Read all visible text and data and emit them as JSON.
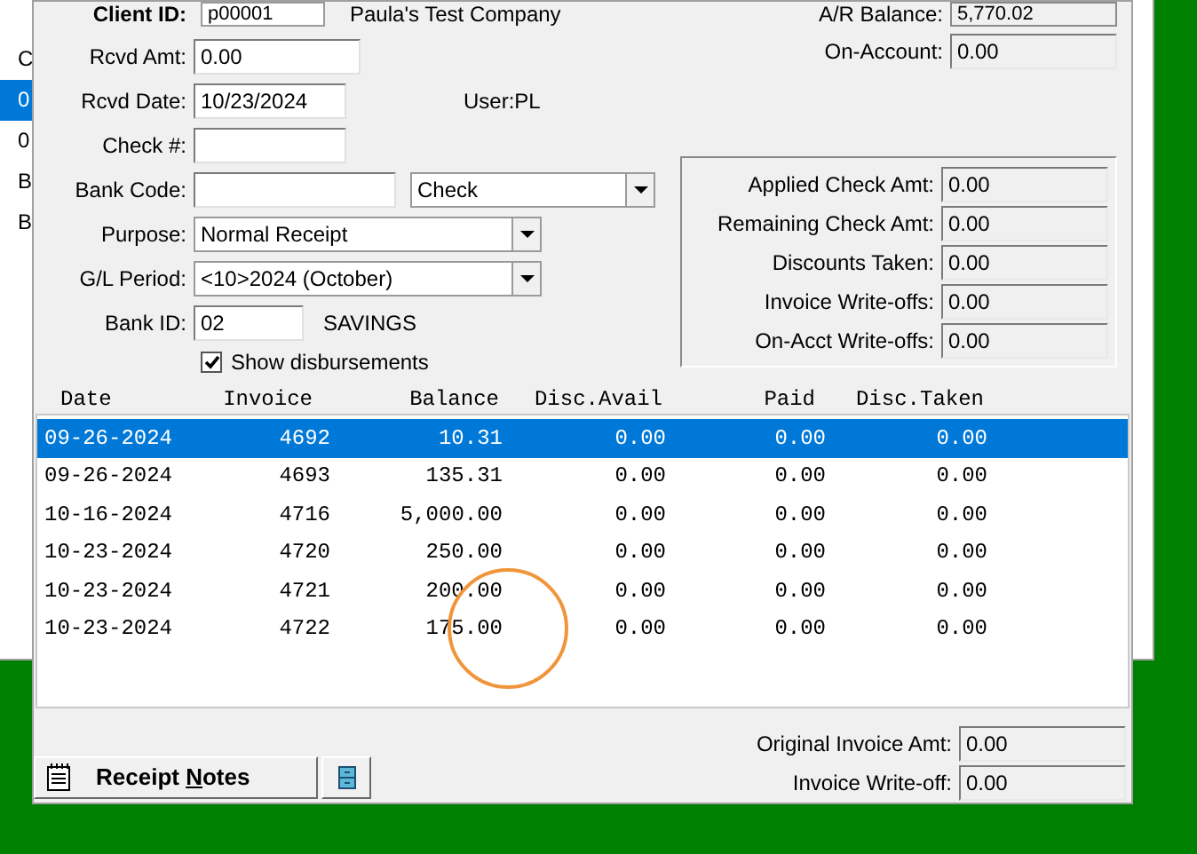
{
  "background_window": {
    "rows": [
      {
        "text": "C",
        "selected": false
      },
      {
        "text": "0",
        "selected": true
      },
      {
        "text": "0",
        "selected": false
      },
      {
        "text": "B",
        "selected": false
      },
      {
        "text": "B",
        "selected": false
      }
    ]
  },
  "header": {
    "client_label": "Client ID:",
    "client_id": "p00001",
    "client_name": "Paula's Test Company",
    "ar_label": "A/R Balance:",
    "ar_value": "5,770.02",
    "on_account_label": "On-Account:",
    "on_account_value": "0.00"
  },
  "form": {
    "rcvd_amt_label": "Rcvd Amt:",
    "rcvd_amt": "0.00",
    "rcvd_date_label": "Rcvd Date:",
    "rcvd_date": "10/23/2024",
    "user": "User:PL",
    "check_label": "Check #:",
    "bank_code_label": "Bank Code:",
    "payment_type": "Check",
    "purpose_label": "Purpose:",
    "purpose": "Normal Receipt",
    "gl_label": "G/L Period:",
    "gl_period": "<10>2024 (October)",
    "bank_id_label": "Bank ID:",
    "bank_id": "02",
    "bank_name": "SAVINGS",
    "show_disbursements": {
      "label": "Show disbursements",
      "checked": true
    }
  },
  "summary": [
    {
      "label": "Applied Check Amt:",
      "value": "0.00"
    },
    {
      "label": "Remaining Check Amt:",
      "value": "0.00"
    },
    {
      "label": "Discounts Taken:",
      "value": "0.00"
    },
    {
      "label": "Invoice Write-offs:",
      "value": "0.00"
    },
    {
      "label": "On-Acct Write-offs:",
      "value": "0.00"
    }
  ],
  "table": {
    "columns": [
      "Date",
      "Invoice",
      "Balance",
      "Disc.Avail",
      "Paid",
      "Disc.Taken"
    ],
    "rows": [
      {
        "cells": [
          "09-26-2024",
          "4692",
          "10.31",
          "0.00",
          "0.00",
          "0.00"
        ],
        "selected": true
      },
      {
        "cells": [
          "09-26-2024",
          "4693",
          "135.31",
          "0.00",
          "0.00",
          "0.00"
        ],
        "selected": false
      },
      {
        "cells": [
          "10-16-2024",
          "4716",
          "5,000.00",
          "0.00",
          "0.00",
          "0.00"
        ],
        "selected": false
      },
      {
        "cells": [
          "10-23-2024",
          "4720",
          "250.00",
          "0.00",
          "0.00",
          "0.00"
        ],
        "selected": false
      },
      {
        "cells": [
          "10-23-2024",
          "4721",
          "200.00",
          "0.00",
          "0.00",
          "0.00"
        ],
        "selected": false
      },
      {
        "cells": [
          "10-23-2024",
          "4722",
          "175.00",
          "0.00",
          "0.00",
          "0.00"
        ],
        "selected": false
      }
    ]
  },
  "footer": {
    "notes_button": {
      "before": "Receipt ",
      "accelerator": "N",
      "after": "otes"
    },
    "original_label": "Original Invoice Amt:",
    "original_value": "0.00",
    "writeoff_label": "Invoice Write-off:",
    "writeoff_value": "0.00"
  }
}
